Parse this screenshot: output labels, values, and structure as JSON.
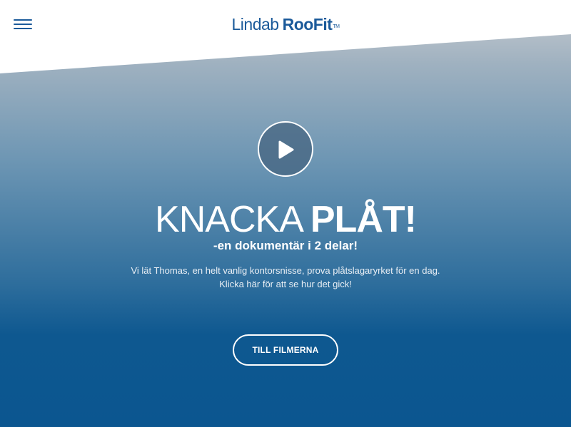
{
  "header": {
    "menu_icon": "hamburger-menu-icon",
    "logo": {
      "light": "Lindab",
      "bold": "RooFit",
      "tm": "TM"
    }
  },
  "hero": {
    "play_icon": "play-icon",
    "headline_light": "KNACKA",
    "headline_bold": "PLÅT!",
    "subtitle": "-en dokumentär i 2 delar!",
    "description_line1": "Vi lät Thomas, en helt vanlig kontorsnisse, prova plåtslagaryrket för en dag.",
    "description_line2": "Klicka här för att se hur det gick!",
    "cta_label": "TILL FILMERNA"
  },
  "colors": {
    "brand_blue": "#1b5a9a",
    "gradient_top": "#c9ccd0",
    "gradient_bottom": "#0b5690"
  }
}
